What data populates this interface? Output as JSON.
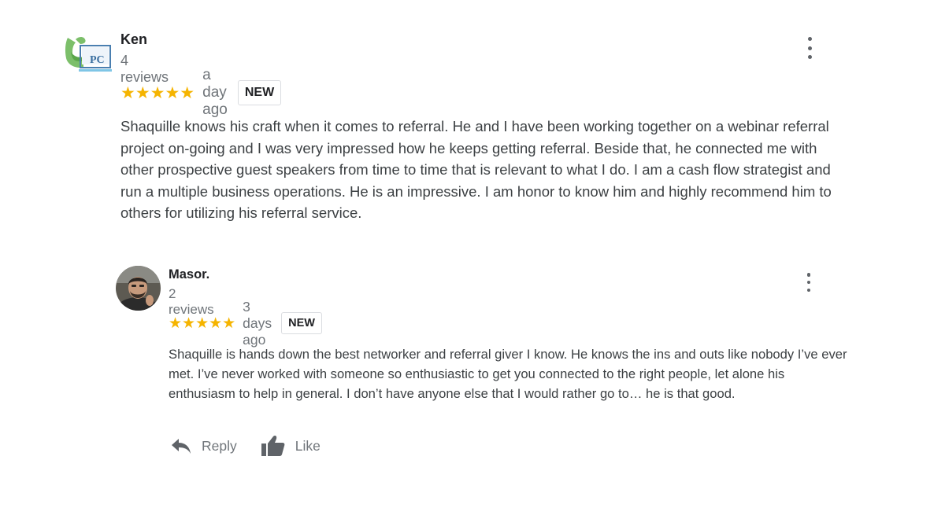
{
  "reviews": [
    {
      "name": "Ken",
      "review_count": "4 reviews",
      "stars": "★★★★★",
      "rating": 5,
      "date": "a day ago",
      "badge": "NEW",
      "avatar_text": "PC",
      "text": "Shaquille knows his craft when it comes to referral.  He and I have been working together on a webinar referral project on-going and I was very impressed how he keeps getting referral.  Beside that, he connected me with other prospective guest speakers from time to time that is relevant to what I do.  I am a cash flow strategist and run a multiple business operations.  He is an impressive.  I am honor to know him and highly recommend him to others for utilizing his referral service."
    },
    {
      "name": "Masor.",
      "review_count": "2 reviews",
      "stars": "★★★★★",
      "rating": 5,
      "date": "3 days ago",
      "badge": "NEW",
      "text": "Shaquille is hands down the best networker and referral giver I know. He knows the ins and outs like nobody I’ve ever met.  I’ve never worked with someone so enthusiastic to get you connected to the right people, let alone his enthusiasm to help in general. I don’t have anyone else that I would rather go to… he is that good."
    }
  ],
  "actions": {
    "reply_label": "Reply",
    "like_label": "Like"
  },
  "colors": {
    "star": "#f5b400",
    "muted_text": "#70757a",
    "body_text": "#3c4043",
    "avatar_green": "#7cbf6a",
    "avatar_blue": "#4a7fb0"
  },
  "icons": {
    "menu": "more-vert-icon",
    "reply": "reply-icon",
    "like": "thumb-up-icon"
  }
}
